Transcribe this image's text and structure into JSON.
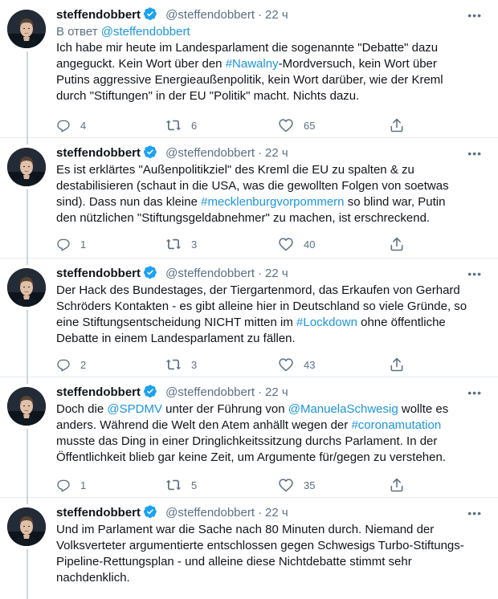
{
  "colors": {
    "link": "#1b95e0",
    "muted": "#5b7083",
    "verified": "#1da1f2",
    "divider": "#e6ecf0"
  },
  "icons": {
    "reply": "comment-icon",
    "retweet": "retweet-icon",
    "like": "heart-icon",
    "share": "share-icon",
    "verified": "verified-badge-icon",
    "more": "more-icon"
  },
  "tweets": [
    {
      "name": "steffendobbert",
      "handle": "@steffendobbert",
      "time": "22 ч",
      "reply_prefix": "В ответ ",
      "reply_to": "@steffendobbert",
      "text": [
        "Ich habe mir heute im Landesparlament die sogenannte \"Debatte\" dazu",
        "angeguckt. Kein Wort über den ",
        "#Nawalny",
        "-Mordversuch, kein Wort über",
        "Putins aggressive Energieaußenpolitik, kein Wort darüber, wie der Kreml",
        "durch \"Stiftungen\" in der EU \"Politik\" macht. Nichts dazu."
      ],
      "replies": "4",
      "retweets": "6",
      "likes": "65"
    },
    {
      "name": "steffendobbert",
      "handle": "@steffendobbert",
      "time": "22 ч",
      "text": [
        "Es ist erklärtes \"Außenpolitikziel\" des Kreml die EU zu spalten & zu",
        "destabilisieren (schaut in die USA, was die gewollten Folgen von soetwas",
        "sind). Dass nun das kleine ",
        "#mecklenburgvorpommern",
        " so blind war, Putin",
        "den nützlichen \"Stiftungsgeldabnehmer\" zu machen, ist erschreckend."
      ],
      "replies": "1",
      "retweets": "3",
      "likes": "40"
    },
    {
      "name": "steffendobbert",
      "handle": "@steffendobbert",
      "time": "22 ч",
      "text": [
        "Der Hack des Bundestages, der Tiergartenmord, das Erkaufen von Gerhard",
        "Schröders Kontakten - es gibt alleine hier in Deutschland so viele Gründe, so",
        "eine Stiftungsentscheidung NICHT mitten im ",
        "#Lockdown",
        " ohne öffentliche",
        "Debatte in einem Landesparlament zu fällen."
      ],
      "replies": "2",
      "retweets": "3",
      "likes": "43"
    },
    {
      "name": "steffendobbert",
      "handle": "@steffendobbert",
      "time": "22 ч",
      "text": [
        "Doch die ",
        "@SPDMV",
        " unter der Führung von ",
        "@ManuelaSchwesig",
        " wollte es",
        "anders. Während die Welt den Atem anhällt wegen der ",
        "#coronamutation",
        "musste das Ding in einer Dringlichkeitssitzung durchs Parlament. In der",
        "Öffentlichkeit blieb gar keine Zeit, um Argumente für/gegen zu verstehen."
      ],
      "replies": "1",
      "retweets": "5",
      "likes": "35"
    },
    {
      "name": "steffendobbert",
      "handle": "@steffendobbert",
      "time": "22 ч",
      "text": [
        "Und im Parlament war die Sache nach 80 Minuten durch. Niemand der",
        "Volksverteter argumentierte entschlossen gegen Schwesigs Turbo-Stiftungs-",
        "Pipeline-Rettungsplan - und alleine diese Nichtdebatte stimmt sehr",
        "nachdenklich."
      ]
    }
  ]
}
